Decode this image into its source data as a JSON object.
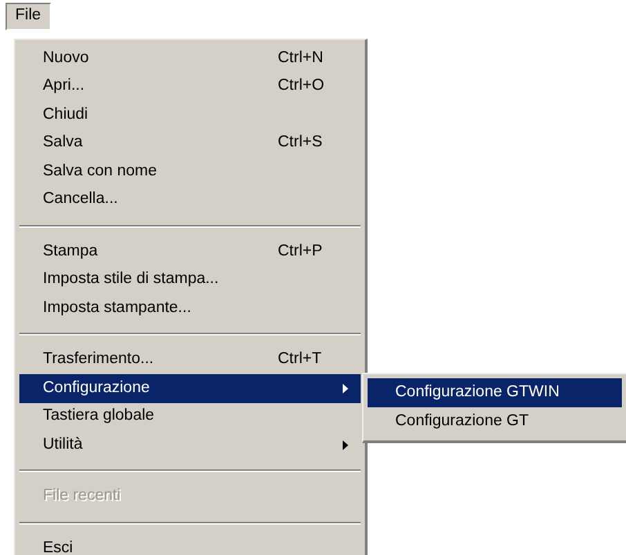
{
  "menu_bar": [
    {
      "label": "File",
      "selected": true
    }
  ],
  "menu": {
    "items": [
      {
        "kind": "item",
        "label": "Nuovo",
        "shortcut": "Ctrl+N",
        "submenu": false,
        "selected": false,
        "disabled": false
      },
      {
        "kind": "item",
        "label": "Apri...",
        "shortcut": "Ctrl+O",
        "submenu": false,
        "selected": false,
        "disabled": false
      },
      {
        "kind": "item",
        "label": "Chiudi",
        "submenu": false,
        "selected": false,
        "disabled": false
      },
      {
        "kind": "item",
        "label": "Salva",
        "shortcut": "Ctrl+S",
        "submenu": false,
        "selected": false,
        "disabled": false
      },
      {
        "kind": "item",
        "label": "Salva con nome",
        "submenu": false,
        "selected": false,
        "disabled": false
      },
      {
        "kind": "item",
        "label": "Cancella...",
        "submenu": false,
        "selected": false,
        "disabled": false
      },
      {
        "kind": "separator"
      },
      {
        "kind": "item",
        "label": "Stampa",
        "shortcut": "Ctrl+P",
        "submenu": false,
        "selected": false,
        "disabled": false
      },
      {
        "kind": "item",
        "label": "Imposta stile di stampa...",
        "submenu": false,
        "selected": false,
        "disabled": false
      },
      {
        "kind": "item",
        "label": "Imposta stampante...",
        "submenu": false,
        "selected": false,
        "disabled": false
      },
      {
        "kind": "separator"
      },
      {
        "kind": "item",
        "label": "Trasferimento...",
        "shortcut": "Ctrl+T",
        "submenu": false,
        "selected": false,
        "disabled": false
      },
      {
        "kind": "item",
        "label": "Configurazione",
        "submenu": true,
        "selected": true,
        "disabled": false
      },
      {
        "kind": "item",
        "label": "Tastiera globale",
        "submenu": false,
        "selected": false,
        "disabled": false
      },
      {
        "kind": "item",
        "label": "Utilità",
        "submenu": true,
        "selected": false,
        "disabled": false
      },
      {
        "kind": "separator"
      },
      {
        "kind": "item",
        "label": "File recenti",
        "submenu": false,
        "selected": false,
        "disabled": true
      },
      {
        "kind": "separator"
      },
      {
        "kind": "item",
        "label": "Esci",
        "submenu": false,
        "selected": false,
        "disabled": false
      }
    ]
  },
  "submenu": {
    "items": [
      {
        "label": "Configurazione GTWIN",
        "selected": true
      },
      {
        "label": "Configurazione GT",
        "selected": false
      }
    ]
  }
}
